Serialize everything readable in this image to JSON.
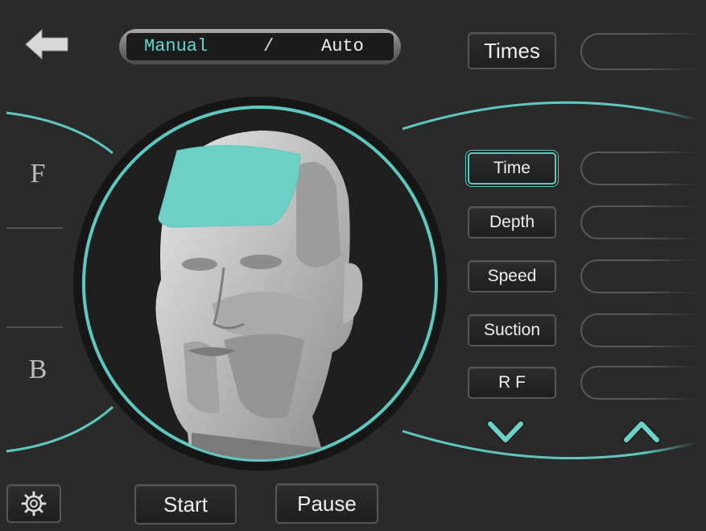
{
  "header": {
    "mode_manual": "Manual",
    "mode_separator": "/",
    "mode_auto": "Auto",
    "times_label": "Times"
  },
  "side": {
    "front_label": "F",
    "back_label": "B"
  },
  "params": {
    "time": "Time",
    "depth": "Depth",
    "speed": "Speed",
    "suction": "Suction",
    "rf": "R F"
  },
  "controls": {
    "start_label": "Start",
    "pause_label": "Pause"
  },
  "colors": {
    "accent": "#5fc7c0",
    "background": "#2a2a2a",
    "selected_zone": "#6dd1c8"
  },
  "icons": {
    "back": "back-arrow-icon",
    "settings": "gear-icon",
    "down": "chevron-down-icon",
    "up": "chevron-up-icon"
  },
  "state": {
    "selected_mode": "Manual",
    "selected_param": "Time",
    "selected_zone": "forehead"
  }
}
